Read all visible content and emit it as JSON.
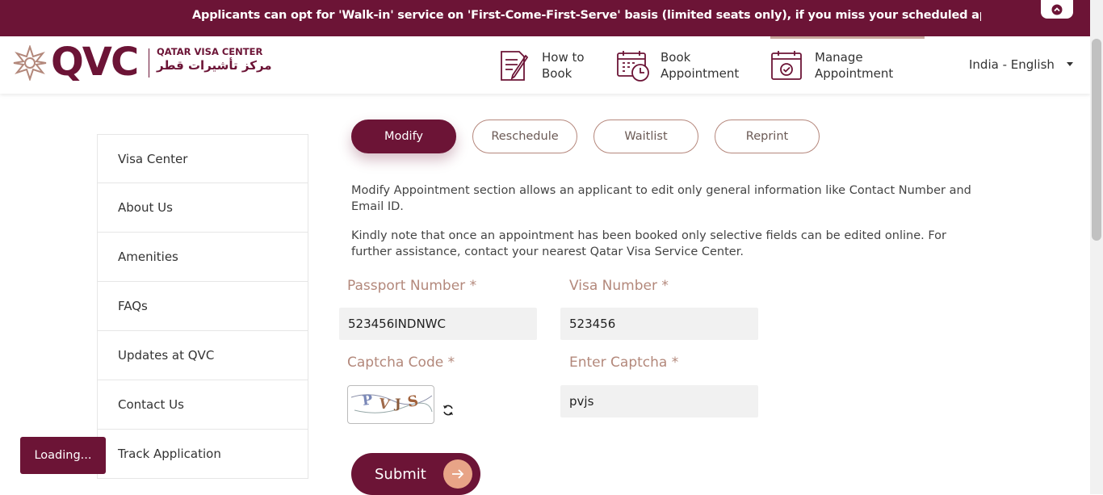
{
  "ticker": {
    "text": "Applicants can opt for 'Walk-in' service on 'First-Come-First-Serve' basis (limited seats only), if you miss your scheduled appointment OR w"
  },
  "logo": {
    "brand": "QVC",
    "name_en": "QATAR VISA CENTER",
    "name_ar": "مركز تأشيرات قطر"
  },
  "nav": [
    {
      "line1": "How to",
      "line2": "Book",
      "icon": "how-to-book-icon"
    },
    {
      "line1": "Book",
      "line2": "Appointment",
      "icon": "calendar-clock-icon"
    },
    {
      "line1": "Manage",
      "line2": "Appointment",
      "icon": "calendar-check-icon"
    }
  ],
  "language": "India - English",
  "sidebar": [
    {
      "label": "Visa Center"
    },
    {
      "label": "About Us"
    },
    {
      "label": "Amenities"
    },
    {
      "label": "FAQs"
    },
    {
      "label": "Updates at QVC"
    },
    {
      "label": "Contact Us"
    },
    {
      "label": "Track Application"
    }
  ],
  "tabs": [
    {
      "label": "Modify",
      "active": true
    },
    {
      "label": "Reschedule",
      "active": false
    },
    {
      "label": "Waitlist",
      "active": false
    },
    {
      "label": "Reprint",
      "active": false
    }
  ],
  "description": [
    "Modify Appointment section allows an applicant to edit only general information like Contact Number and Email ID.",
    "Kindly note that once an appointment has been booked only selective fields can be edited online. For further assistance, contact your nearest Qatar Visa Service Center."
  ],
  "form": {
    "passport_label": "Passport Number *",
    "passport_value": "523456INDNWC",
    "visa_label": "Visa Number *",
    "visa_value": "523456",
    "captcha_label": "Captcha Code *",
    "captcha_image_text": "PVJS",
    "enter_captcha_label": "Enter Captcha *",
    "enter_captcha_value": "pvjs",
    "submit_label": "Submit"
  },
  "loading_text": "Loading...",
  "colors": {
    "brand": "#6c1436",
    "accent": "#e8a487",
    "label": "#b3887b"
  }
}
